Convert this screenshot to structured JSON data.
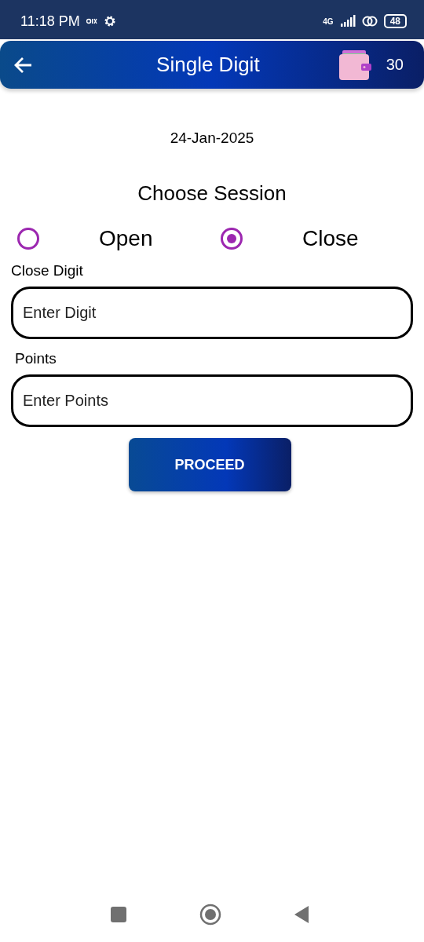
{
  "status_bar": {
    "time": "11:18 PM",
    "network": "4G",
    "battery": "48"
  },
  "header": {
    "title": "Single Digit",
    "wallet_balance": "30"
  },
  "date": "24-Jan-2025",
  "session": {
    "title": "Choose Session",
    "options": [
      {
        "label": "Open",
        "selected": false
      },
      {
        "label": "Close",
        "selected": true
      }
    ]
  },
  "fields": [
    {
      "label": "Close Digit",
      "placeholder": "Enter Digit"
    },
    {
      "label": "Points",
      "placeholder": "Enter Points"
    }
  ],
  "button": "PROCEED"
}
